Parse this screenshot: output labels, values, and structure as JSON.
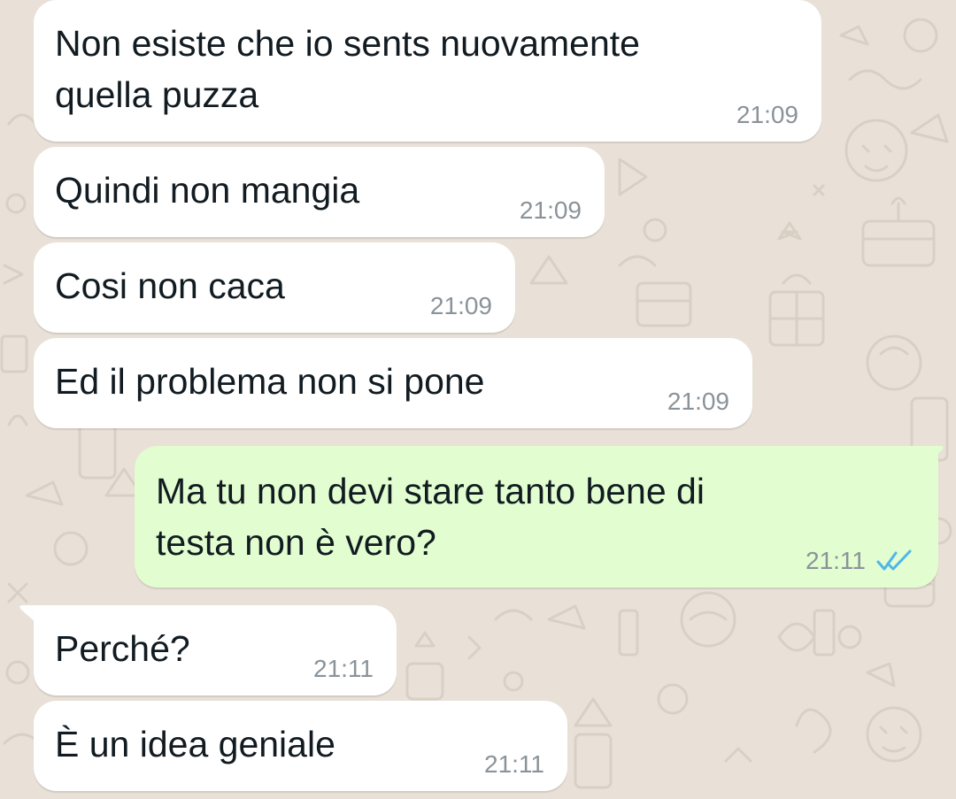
{
  "colors": {
    "incoming_bubble": "#ffffff",
    "outgoing_bubble": "#e2fdcf",
    "wallpaper": "#e9e1d8",
    "timestamp": "#8a9399",
    "read_ticks": "#4fb6ec"
  },
  "messages": [
    {
      "direction": "incoming",
      "lines": [
        "Non esiste che io sents nuovamente",
        "quella puzza"
      ],
      "time": "21:09"
    },
    {
      "direction": "incoming",
      "lines": [
        "Quindi non mangia"
      ],
      "time": "21:09"
    },
    {
      "direction": "incoming",
      "lines": [
        "Cosi non caca"
      ],
      "time": "21:09"
    },
    {
      "direction": "incoming",
      "lines": [
        "Ed il problema non si pone"
      ],
      "time": "21:09"
    },
    {
      "direction": "outgoing",
      "lines": [
        "Ma tu non devi stare tanto bene di",
        "testa non è vero?"
      ],
      "time": "21:11",
      "status_icon": "double-check-read-icon"
    },
    {
      "direction": "incoming",
      "lines": [
        "Perché?"
      ],
      "time": "21:11"
    },
    {
      "direction": "incoming",
      "lines": [
        "È un idea geniale"
      ],
      "time": "21:11"
    }
  ]
}
